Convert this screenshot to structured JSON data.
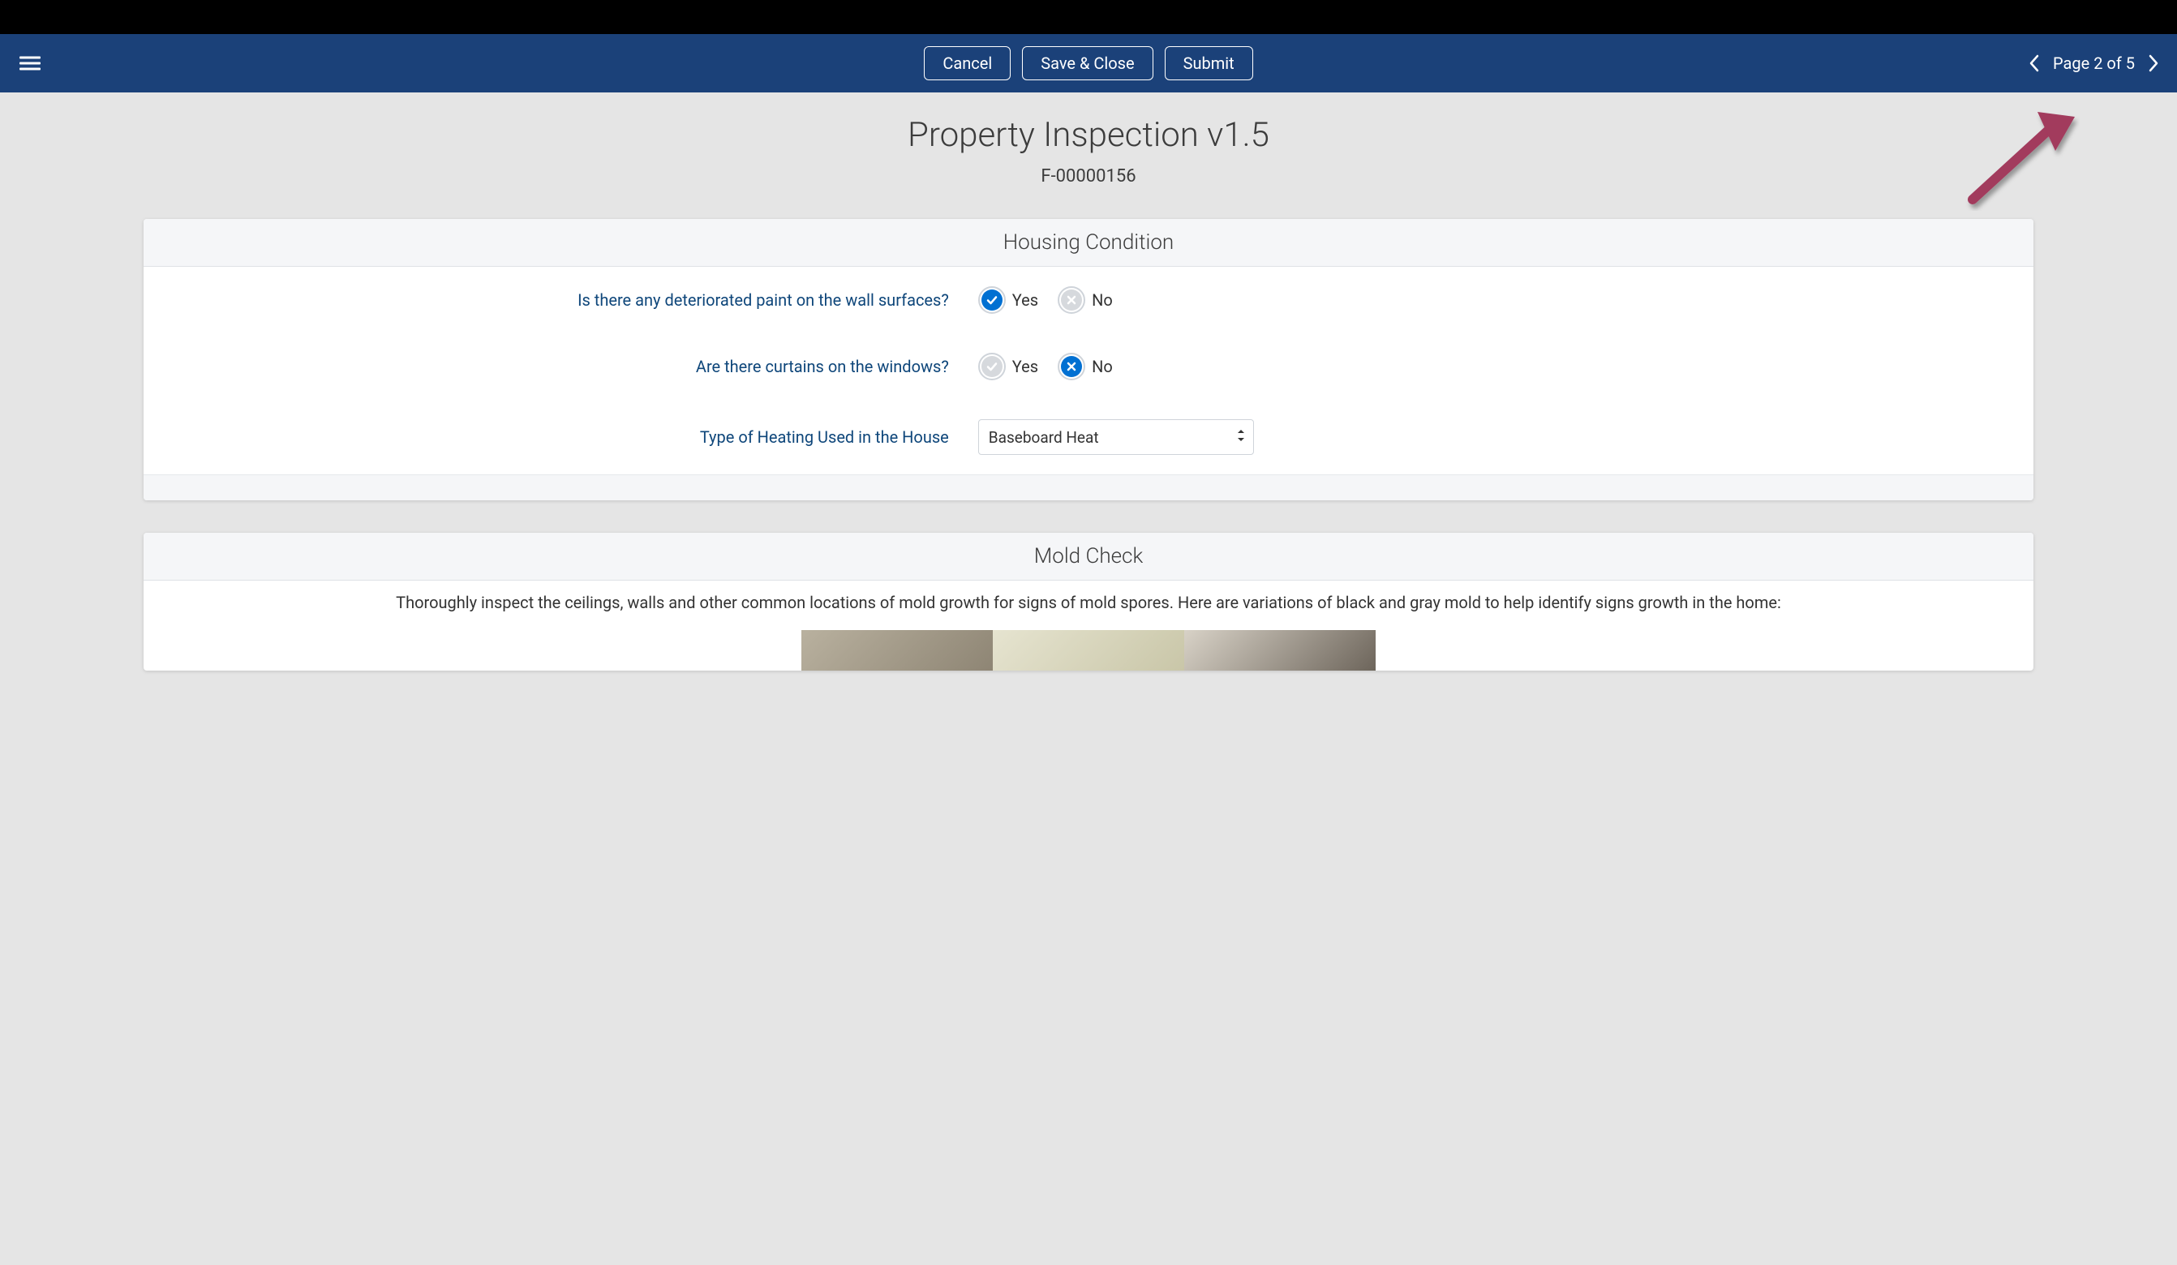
{
  "header": {
    "cancel": "Cancel",
    "save_close": "Save & Close",
    "submit": "Submit",
    "page_indicator": "Page 2 of 5"
  },
  "page": {
    "title": "Property Inspection v1.5",
    "record_id": "F-00000156"
  },
  "housing": {
    "section_title": "Housing Condition",
    "q1": {
      "label": "Is there any deteriorated paint on the wall surfaces?",
      "yes": "Yes",
      "no": "No",
      "value": "yes"
    },
    "q2": {
      "label": "Are there curtains on the windows?",
      "yes": "Yes",
      "no": "No",
      "value": "no"
    },
    "q3": {
      "label": "Type of Heating Used in the House",
      "value": "Baseboard Heat"
    }
  },
  "mold": {
    "section_title": "Mold Check",
    "description": "Thoroughly inspect the ceilings, walls and other common locations of mold growth for signs of mold spores. Here are variations of black and gray mold to help identify signs growth in the home:"
  }
}
